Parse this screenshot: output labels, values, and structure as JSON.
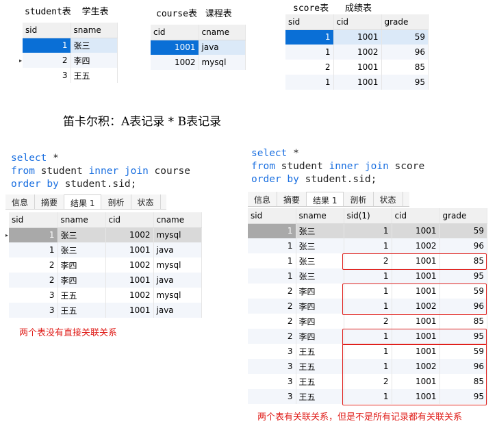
{
  "student": {
    "title": "student表",
    "subtitle": "学生表",
    "columns": [
      "sid",
      "sname"
    ],
    "rows": [
      [
        "1",
        "张三"
      ],
      [
        "2",
        "李四"
      ],
      [
        "3",
        "王五"
      ]
    ]
  },
  "course": {
    "title": "course表",
    "subtitle": "课程表",
    "columns": [
      "cid",
      "cname"
    ],
    "rows": [
      [
        "1001",
        "java"
      ],
      [
        "1002",
        "mysql"
      ]
    ]
  },
  "score": {
    "title": "score表",
    "subtitle": "成绩表",
    "columns": [
      "sid",
      "cid",
      "grade"
    ],
    "rows": [
      [
        "1",
        "1001",
        "59"
      ],
      [
        "1",
        "1002",
        "96"
      ],
      [
        "2",
        "1001",
        "85"
      ],
      [
        "1",
        "1001",
        "95"
      ]
    ]
  },
  "cartesian_caption": "笛卡尔积：A表记录 * B表记录",
  "query_left": {
    "line1_kw": "select",
    "line1_rest": " *",
    "line2_kw": "from",
    "line2_mid": " student ",
    "line2_kw2": "inner join",
    "line2_rest": " course",
    "line3_kw": "order by",
    "line3_rest": " student.sid;"
  },
  "query_right": {
    "line1_kw": "select",
    "line1_rest": " *",
    "line2_kw": "from",
    "line2_mid": " student ",
    "line2_kw2": "inner join",
    "line2_rest": " score",
    "line3_kw": "order by",
    "line3_rest": " student.sid;"
  },
  "tabs": [
    "信息",
    "摘要",
    "结果 1",
    "剖析",
    "状态"
  ],
  "result_left": {
    "columns": [
      "sid",
      "sname",
      "cid",
      "cname"
    ],
    "rows": [
      [
        "1",
        "张三",
        "1002",
        "mysql"
      ],
      [
        "1",
        "张三",
        "1001",
        "java"
      ],
      [
        "2",
        "李四",
        "1002",
        "mysql"
      ],
      [
        "2",
        "李四",
        "1001",
        "java"
      ],
      [
        "3",
        "王五",
        "1002",
        "mysql"
      ],
      [
        "3",
        "王五",
        "1001",
        "java"
      ]
    ]
  },
  "note_left": "两个表没有直接关联关系",
  "result_right": {
    "columns": [
      "sid",
      "sname",
      "sid(1)",
      "cid",
      "grade"
    ],
    "rows": [
      [
        "1",
        "张三",
        "1",
        "1001",
        "59"
      ],
      [
        "1",
        "张三",
        "1",
        "1002",
        "96"
      ],
      [
        "1",
        "张三",
        "2",
        "1001",
        "85"
      ],
      [
        "1",
        "张三",
        "1",
        "1001",
        "95"
      ],
      [
        "2",
        "李四",
        "1",
        "1001",
        "59"
      ],
      [
        "2",
        "李四",
        "1",
        "1002",
        "96"
      ],
      [
        "2",
        "李四",
        "2",
        "1001",
        "85"
      ],
      [
        "2",
        "李四",
        "1",
        "1001",
        "95"
      ],
      [
        "3",
        "王五",
        "1",
        "1001",
        "59"
      ],
      [
        "3",
        "王五",
        "1",
        "1002",
        "96"
      ],
      [
        "3",
        "王五",
        "2",
        "1001",
        "85"
      ],
      [
        "3",
        "王五",
        "1",
        "1001",
        "95"
      ]
    ]
  },
  "note_right": "两个表有关联关系，但是不是所有记录都有关联关系",
  "colors": {
    "keyword": "#1a6fe0",
    "highlight": "#e0201c",
    "selection": "#0a6fd6"
  }
}
